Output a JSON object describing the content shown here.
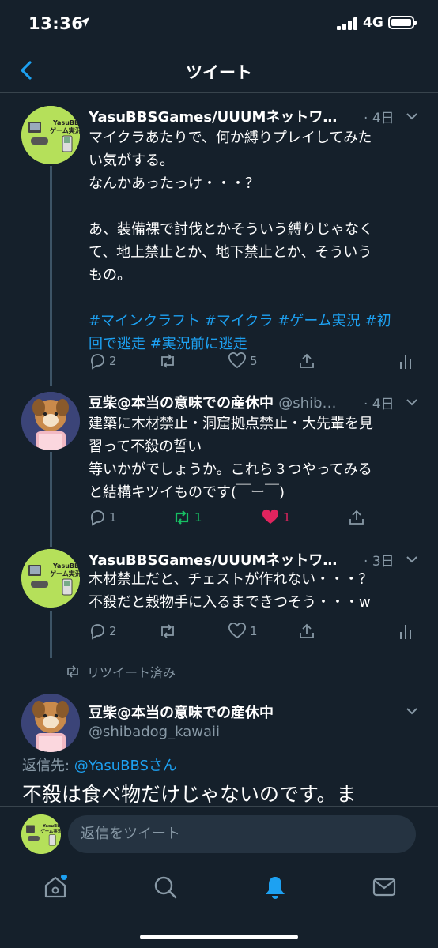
{
  "status_bar": {
    "time": "13:36",
    "network": "4G"
  },
  "nav": {
    "title": "ツイート"
  },
  "tweets": [
    {
      "name": "YasuBBSGames/UUUMネットワ…",
      "handle": "",
      "dot": "·",
      "time": "4日",
      "lines": [
        "マイクラあたりで、何か縛りプレイしてみた",
        "い気がする。",
        "なんかあったっけ・・・？",
        "",
        "あ、装備裸で討伐とかそういう縛りじゃなく",
        "て、地上禁止とか、地下禁止とか、そういう",
        "もの。",
        ""
      ],
      "hashtags_line1": "#マインクラフト #マイクラ #ゲーム実況 #初",
      "hashtags_line2": "回で逃走 #実況前に逃走",
      "replies": "2",
      "retweets": "",
      "likes": "5",
      "avatar_text": [
        "YasuBBS",
        "ゲーム実況"
      ]
    },
    {
      "name": "豆柴@本当の意味での産休中",
      "handle": "@shib…",
      "dot": "·",
      "time": "4日",
      "lines": [
        "建築に木材禁止・洞窟拠点禁止・大先輩を見",
        "習って不殺の誓い",
        "等いかがでしょうか。これら３つやってみる",
        "と結構キツイものです(￣ー￣)"
      ],
      "replies": "1",
      "retweets": "1",
      "likes": "1"
    },
    {
      "name": "YasuBBSGames/UUUMネットワ…",
      "handle": "",
      "dot": "·",
      "time": "3日",
      "lines": [
        "木材禁止だと、チェストが作れない・・・？",
        "不殺だと穀物手に入るまできつそう・・・w"
      ],
      "replies": "2",
      "retweets": "",
      "likes": "1"
    }
  ],
  "retweeted_label": "リツイート済み",
  "focus_tweet": {
    "name": "豆柴@本当の意味での産休中",
    "handle": "@shibadog_kawaii",
    "reply_prefix": "返信先: ",
    "reply_mention": "@YasuBBSさん",
    "text": "不殺は食べ物だけじゃないのです。ま"
  },
  "reply_bar": {
    "placeholder": "返信をツイート"
  },
  "colors": {
    "background": "#15202b",
    "accent": "#1da1f2",
    "muted": "#8899a6",
    "retweet_green": "#17bf63",
    "like_red": "#e0245e"
  },
  "tabs": [
    "home-icon",
    "search-icon",
    "notifications-icon",
    "messages-icon"
  ]
}
